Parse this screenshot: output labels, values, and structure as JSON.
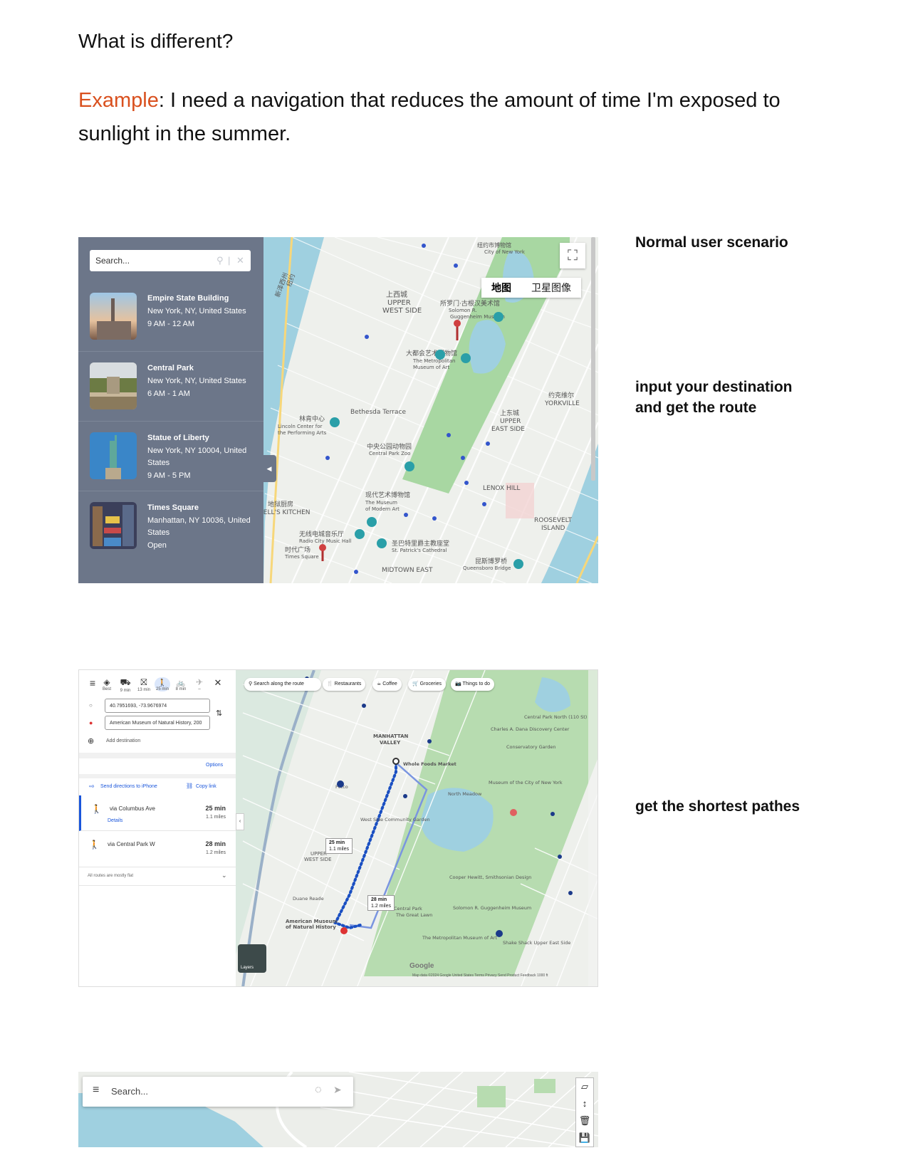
{
  "heading": "What is different?",
  "example": {
    "label": "Example",
    "text": ": I need a navigation that reduces the amount of time I'm exposed to sunlight in the summer."
  },
  "colors": {
    "accent": "#d9501e",
    "sidebar": "#6c7689",
    "park": "#a8d7a2",
    "water": "#9fd0e0",
    "route": "#1a4fc2"
  },
  "side_labels": [
    "Normal user scenario",
    "input your destination and get the route",
    "get the shortest pathes"
  ],
  "panel1": {
    "search_placeholder": "Search...",
    "map_type": [
      "地图",
      "卫星图像"
    ],
    "places": [
      {
        "name": "Empire State Building",
        "address": "New York, NY, United States",
        "hours": "9 AM - 12 AM"
      },
      {
        "name": "Central Park",
        "address": "New York, NY, United States",
        "hours": "6 AM - 1 AM"
      },
      {
        "name": "Statue of Liberty",
        "address": "New York, NY 10004, United States",
        "hours": "9 AM - 5 PM"
      },
      {
        "name": "Times Square",
        "address": "Manhattan, NY 10036, United States",
        "hours": "Open"
      }
    ],
    "map_labels": [
      "上西城",
      "UPPER",
      "WEST SIDE",
      "大都会艺术博物馆",
      "The Metropolitan",
      "Museum of Art",
      "Bethesda Terrace",
      "林肯中心",
      "Lincoln Center for",
      "the Performing Arts",
      "中央公园动物园",
      "Central Park Zoo",
      "上东城",
      "UPPER",
      "EAST SIDE",
      "LENOX HILL",
      "现代艺术博物馆",
      "The Museum",
      "of Modern Art",
      "地狱厨房",
      "HELL'S KITCHEN",
      "无线电城音乐厅",
      "Radio City Music Hall",
      "时代广场",
      "Times Square",
      "圣巴特里爵主教座堂",
      "St. Patrick's Cathedral",
      "MIDTOWN EAST",
      "昆斯博罗桥",
      "Queensboro Bridge",
      "约克维尔",
      "YORKVILLE",
      "ROOSEVELT",
      "ISLAND",
      "新泽西州",
      "纽约",
      "所罗门·古根汉美术馆",
      "Solomon R.",
      "Guggenheim Museum",
      "纽约市博物馆",
      "City of New York"
    ]
  },
  "panel2": {
    "modes": [
      {
        "icon": "◈",
        "label": "Best"
      },
      {
        "icon": "⛟",
        "label": "9 min"
      },
      {
        "icon": "⛝",
        "label": "13 min"
      },
      {
        "icon": "🚶",
        "label": "25 min"
      },
      {
        "icon": "🚲",
        "label": "8 min"
      },
      {
        "icon": "✈",
        "label": "–"
      }
    ],
    "origin": "40.7951693, -73.9676974",
    "destination": "American Museum of Natural History, 200",
    "add_destination": "Add destination",
    "options": "Options",
    "send_directions": "Send directions to iPhone",
    "copy_link": "Copy link",
    "routes": [
      {
        "via": "via Columbus Ave",
        "duration": "25 min",
        "distance": "1.1 miles",
        "details": "Details"
      },
      {
        "via": "via Central Park W",
        "duration": "28 min",
        "distance": "1.2 miles"
      }
    ],
    "note": "All routes are mostly flat",
    "search_route": "Search along the route",
    "chips": [
      "Restaurants",
      "Coffee",
      "Groceries",
      "Things to do"
    ],
    "map_labels": [
      "MANHATTAN",
      "VALLEY",
      "UPPER",
      "WEST SIDE",
      "Whole Foods Market",
      "Petco",
      "West Side Community Garden",
      "North Meadow",
      "Museum of the City of New York",
      "Cooper Hewitt, Smithsonian Design",
      "Solomon R. Guggenheim Museum",
      "Central Park",
      "The Great Lawn",
      "The Metropolitan Museum of Art",
      "American Museum of Natural History",
      "Duane Reade",
      "Shake Shack Upper East Side",
      "Conservatory Garden",
      "Charles A. Dana Discovery Center",
      "Central Park North (110 St)"
    ],
    "bubble1": {
      "time": "25 min",
      "dist": "1.1 miles"
    },
    "bubble2": {
      "time": "28 min",
      "dist": "1.2 miles"
    },
    "layers": "Layers",
    "google": "Google",
    "footer": "Map data ©2024 Google   United States   Terms   Privacy   Send Product Feedback   1000 ft"
  },
  "panel3": {
    "search_placeholder": "Search..."
  }
}
